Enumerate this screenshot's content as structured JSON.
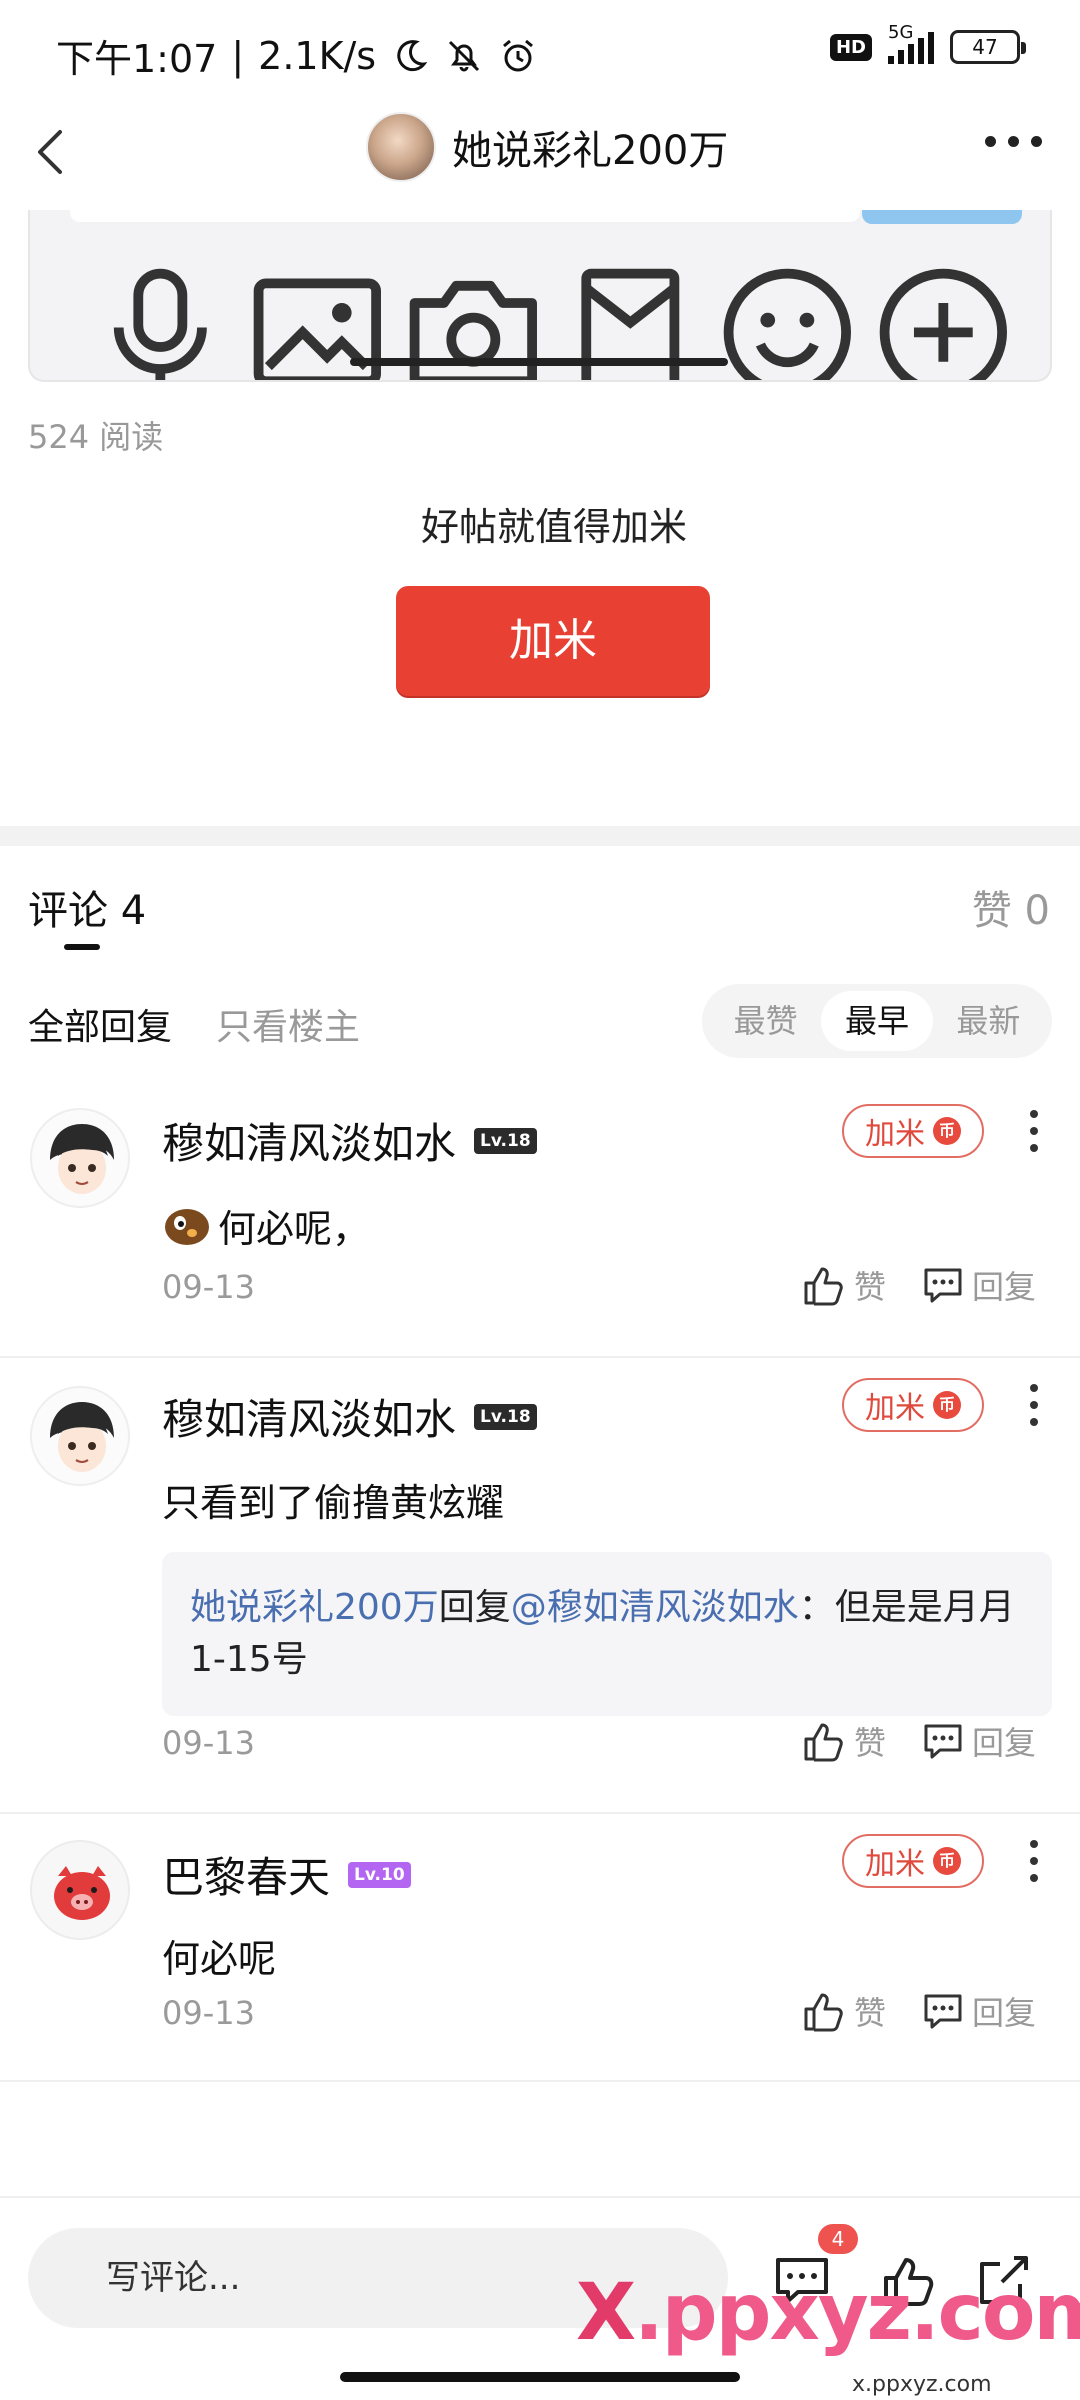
{
  "status_bar": {
    "time": "下午1:07",
    "net_speed": "2.1K/s",
    "hd": "HD",
    "network": "5G",
    "battery": "47"
  },
  "nav": {
    "title": "她说彩礼200万"
  },
  "post": {
    "reads": "524 阅读",
    "tip": "好帖就值得加米",
    "jiami_button": "加米"
  },
  "comments_header": {
    "title": "评论 4",
    "likes": "赞 0",
    "filters": [
      "全部回复",
      "只看楼主"
    ],
    "sort": [
      "最赞",
      "最早",
      "最新"
    ],
    "sort_selected": "最早"
  },
  "comments": [
    {
      "user": "穆如清风淡如水",
      "level": "Lv.18",
      "text": "何必呢，",
      "date": "09-13",
      "jiami": "加米",
      "like": "赞",
      "reply": "回复"
    },
    {
      "user": "穆如清风淡如水",
      "level": "Lv.18",
      "text": "只看到了偷撸黄炫耀",
      "date": "09-13",
      "jiami": "加米",
      "like": "赞",
      "reply": "回复",
      "quote": {
        "from": "她说彩礼200万",
        "verb": "回复",
        "to": "@穆如清风淡如水",
        "sep": "：",
        "body": "但是是月月1-15号"
      }
    },
    {
      "user": "巴黎春天",
      "level": "Lv.10",
      "text": "何必呢",
      "date": "09-13",
      "jiami": "加米",
      "like": "赞",
      "reply": "回复"
    }
  ],
  "bottom_bar": {
    "input_placeholder": "写评论...",
    "comment_count_badge": "4"
  },
  "watermark": {
    "main_x": "X",
    "main_rest": ".ppxyz.com",
    "sub": "x.ppxyz.com"
  },
  "colors": {
    "accent_red": "#e84033",
    "link_blue": "#4a6fb0",
    "level_purple": "#b266f2"
  }
}
